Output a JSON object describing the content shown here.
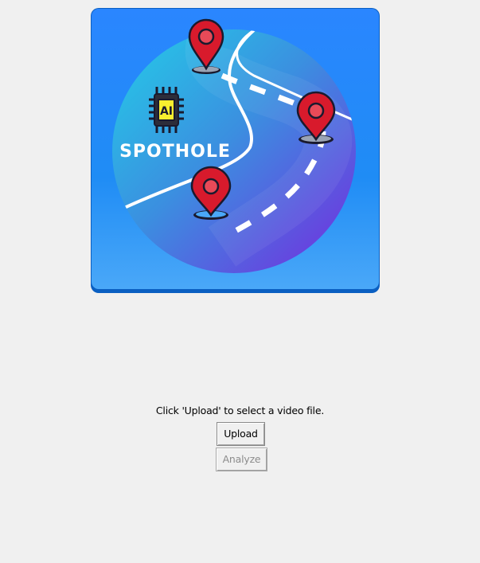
{
  "logo": {
    "text": "SPOTHOLE",
    "chip_text": "AI",
    "colors": {
      "frame_top": "#2f8cff",
      "frame_bottom": "#0d6fe0",
      "circle_start": "#2bb7e8",
      "circle_end": "#6b3fe0",
      "pin": "#d81a2c",
      "chip": "#f7ee2f"
    }
  },
  "status": {
    "text": "Click 'Upload' to select a video file."
  },
  "buttons": {
    "upload_label": "Upload",
    "analyze_label": "Analyze",
    "analyze_enabled": false
  }
}
